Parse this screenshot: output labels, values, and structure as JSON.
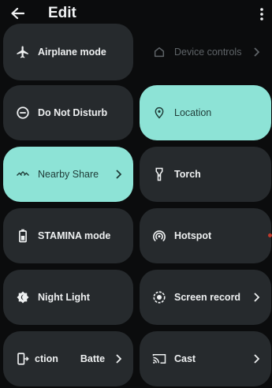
{
  "header": {
    "title": "Edit"
  },
  "tiles": [
    {
      "label": "Airplane mode",
      "icon": "airplane-icon",
      "state": "off"
    },
    {
      "label": "Device controls",
      "icon": "home-icon",
      "state": "unavailable"
    },
    {
      "label": "Do Not Disturb",
      "icon": "do-not-disturb-icon",
      "state": "off"
    },
    {
      "label": "Location",
      "icon": "location-pin-icon",
      "state": "on"
    },
    {
      "label": "Nearby Share",
      "icon": "nearby-share-icon",
      "state": "on"
    },
    {
      "label": "Torch",
      "icon": "torch-icon",
      "state": "off"
    },
    {
      "label": "STAMINA mode",
      "icon": "battery-icon",
      "state": "off"
    },
    {
      "label": "Hotspot",
      "icon": "hotspot-icon",
      "state": "off"
    },
    {
      "label": "Night Light",
      "icon": "night-light-icon",
      "state": "off"
    },
    {
      "label": "Screen record",
      "icon": "screen-record-icon",
      "state": "off"
    },
    {
      "label_left": "ction",
      "label_right": "Batte",
      "icon": "screen-switch-icon",
      "state": "off"
    },
    {
      "label": "Cast",
      "icon": "cast-icon",
      "state": "off"
    }
  ],
  "colors": {
    "background": "#0b0c0d",
    "tile": "#262a2d",
    "active": "#8de3d6"
  }
}
